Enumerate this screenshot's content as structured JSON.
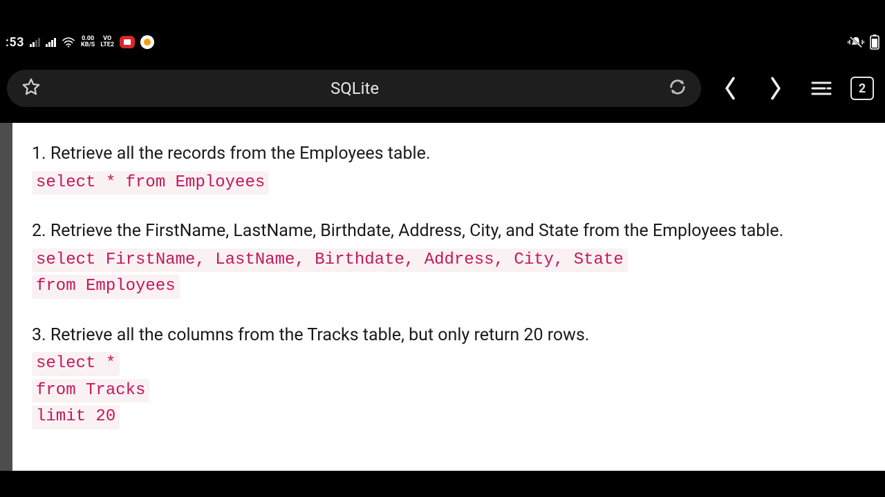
{
  "status": {
    "clock": ":53",
    "net_rate_top": "0.00",
    "net_rate_bottom": "KB/S",
    "volte_top": "VO",
    "volte_bottom": "LTE2"
  },
  "browser": {
    "title": "SQLite",
    "tab_count": "2"
  },
  "items": [
    {
      "prompt": "1. Retrieve all the records from the Employees table.",
      "code": [
        "select * from Employees"
      ]
    },
    {
      "prompt": "2. Retrieve the FirstName, LastName, Birthdate, Address, City, and State from the Employees table.",
      "code": [
        "select FirstName, LastName, Birthdate, Address, City, State",
        "from Employees"
      ]
    },
    {
      "prompt": "3. Retrieve all the columns from the Tracks table, but only return 20 rows.",
      "code": [
        "select *",
        "from Tracks",
        "limit 20"
      ]
    }
  ]
}
